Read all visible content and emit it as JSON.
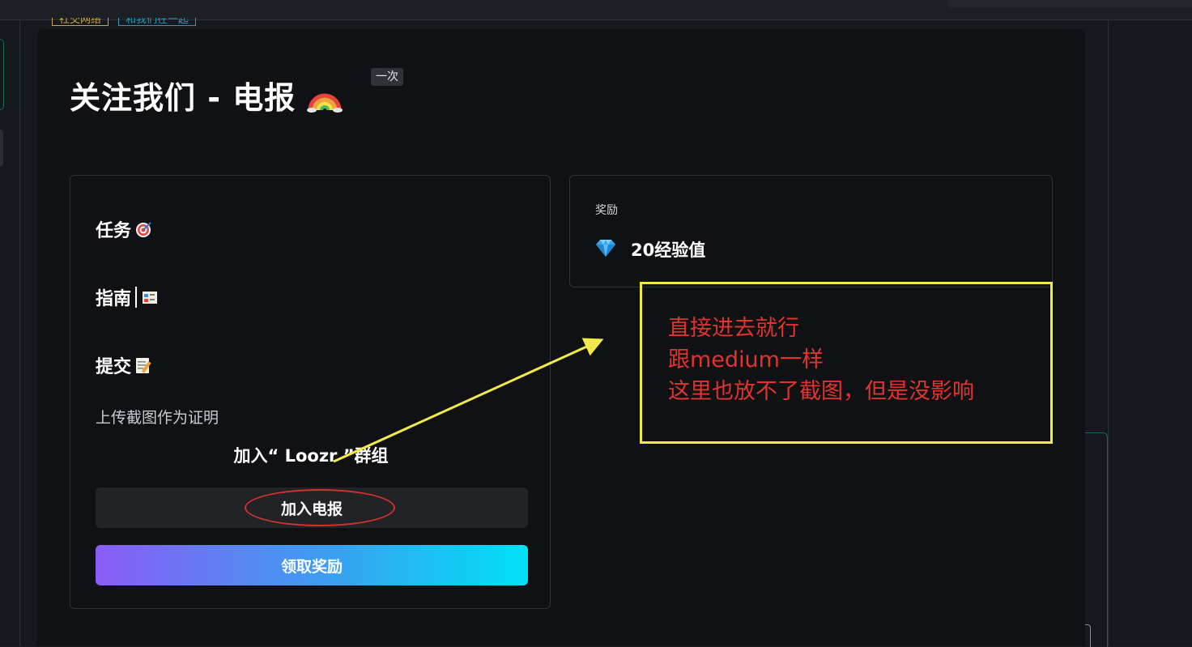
{
  "background": {
    "tags": [
      "社交网络",
      "和我们在一起"
    ]
  },
  "modal": {
    "title": "关注我们 - 电报",
    "title_emoji": "rainbow-icon",
    "badge": "一次"
  },
  "task_card": {
    "task_label": "任务",
    "task_emoji": "direct-hit-icon",
    "guide_label": "指南",
    "guide_emoji": "guide-icon",
    "submit_label": "提交",
    "submit_emoji": "memo-icon",
    "upload_text": "上传截图作为证明",
    "join_group_text": "加入“ Loozr ”群组",
    "join_button_label": "加入电报",
    "claim_button_label": "领取奖励"
  },
  "reward_card": {
    "label": "奖励",
    "icon": "diamond-icon",
    "value": "20经验值"
  },
  "annotation": {
    "lines": [
      "直接进去就行",
      "跟medium一样",
      "这里也放不了截图，但是没影响"
    ],
    "box_color": "#f2e84a",
    "text_color": "#e2332c",
    "ellipse_color": "#d3322c"
  },
  "colors": {
    "modal_bg": "#0f1114",
    "card_border": "#2d3138",
    "join_button_bg": "#212327",
    "claim_gradient_start": "#8a5cf6",
    "claim_gradient_end": "#00e1f5",
    "diamond": "#3aa8f0"
  }
}
